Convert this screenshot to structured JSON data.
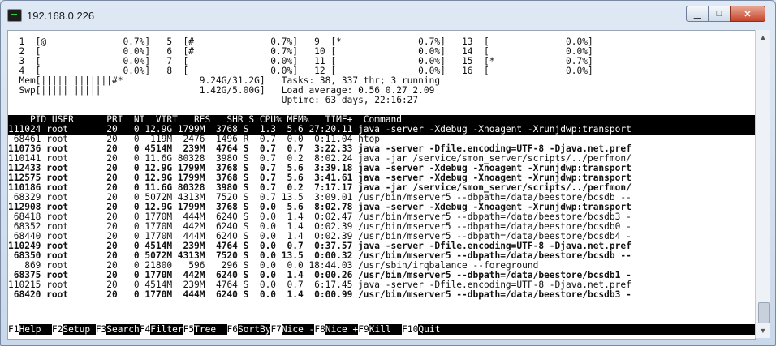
{
  "window": {
    "title": "192.168.0.226",
    "minimize": "▁",
    "maximize": "□",
    "close": "✕"
  },
  "scrollbar": {
    "up": "▲",
    "down": "▼"
  },
  "meters": [
    "  1  [@              0.7%]   5  [#              0.7%]   9  [*              0.7%]   13  [              0.0%]",
    "  2  [               0.0%]   6  [#              0.7%]   10 [               0.0%]   14  [              0.0%]",
    "  3  [               0.0%]   7  [               0.0%]   11 [               0.0%]   15  [*             0.7%]",
    "  4  [               0.0%]   8  [               0.0%]   12 [               0.0%]   16  [              0.0%]",
    "  Mem[|||||||||||||#*              9.24G/31.2G]   Tasks: 38, 337 thr; 3 running",
    "  Swp[|||||||||||                  1.42G/5.00G]   Load average: 0.56 0.27 2.09",
    "                                                  Uptime: 63 days, 22:16:27"
  ],
  "table": {
    "header": "    PID USER      PRI  NI  VIRT   RES   SHR S CPU% MEM%   TIME+  Command",
    "rows": [
      "111024 root       20   0 12.9G 1799M  3768 S  1.3  5.6 27:20.11 java -server -Xdebug -Xnoagent -Xrunjdwp:transport",
      " 68461 root       20   0  119M  2476  1496 R  0.7  0.0  0:11.04 htop",
      "110736 root       20   0 4514M  239M  4764 S  0.7  0.7  3:22.33 java -server -Dfile.encoding=UTF-8 -Djava.net.pref",
      "110141 root       20   0 11.6G 80328  3980 S  0.7  0.2  8:02.24 java -jar /service/smon_server/scripts/../perfmon/",
      "112433 root       20   0 12.9G 1799M  3768 S  0.7  5.6  3:39.18 java -server -Xdebug -Xnoagent -Xrunjdwp:transport",
      "112575 root       20   0 12.9G 1799M  3768 S  0.7  5.6  3:41.61 java -server -Xdebug -Xnoagent -Xrunjdwp:transport",
      "110186 root       20   0 11.6G 80328  3980 S  0.7  0.2  7:17.17 java -jar /service/smon_server/scripts/../perfmon/",
      " 68329 root       20   0 5072M 4313M  7520 S  0.7 13.5  3:09.01 /usr/bin/mserver5 --dbpath=/data/beestore/bcsdb --",
      "112908 root       20   0 12.9G 1799M  3768 S  0.0  5.6  8:02.78 java -server -Xdebug -Xnoagent -Xrunjdwp:transport",
      " 68418 root       20   0 1770M  444M  6240 S  0.0  1.4  0:02.47 /usr/bin/mserver5 --dbpath=/data/beestore/bcsdb3 -",
      " 68352 root       20   0 1770M  442M  6240 S  0.0  1.4  0:02.39 /usr/bin/mserver5 --dbpath=/data/beestore/bcsdb0 -",
      " 68440 root       20   0 1770M  444M  6240 S  0.0  1.4  0:02.39 /usr/bin/mserver5 --dbpath=/data/beestore/bcsdb4 -",
      "110249 root       20   0 4514M  239M  4764 S  0.0  0.7  0:37.57 java -server -Dfile.encoding=UTF-8 -Djava.net.pref",
      " 68350 root       20   0 5072M 4313M  7520 S  0.0 13.5  0:00.32 /usr/bin/mserver5 --dbpath=/data/beestore/bcsdb --",
      "   869 root       20   0 21800   596   296 S  0.0  0.0 18:44.03 /usr/sbin/irqbalance --foreground",
      " 68375 root       20   0 1770M  442M  6240 S  0.0  1.4  0:00.26 /usr/bin/mserver5 --dbpath=/data/beestore/bcsdb1 -",
      "110215 root       20   0 4514M  239M  4764 S  0.0  0.7  6:17.45 java -server -Dfile.encoding=UTF-8 -Djava.net.pref",
      " 68420 root       20   0 1770M  444M  6240 S  0.0  1.4  0:00.99 /usr/bin/mserver5 --dbpath=/data/beestore/bcsdb3 -"
    ]
  },
  "footer": [
    {
      "key": "F1",
      "label": "Help  "
    },
    {
      "key": "F2",
      "label": "Setup "
    },
    {
      "key": "F3",
      "label": "Search"
    },
    {
      "key": "F4",
      "label": "Filter"
    },
    {
      "key": "F5",
      "label": "Tree  "
    },
    {
      "key": "F6",
      "label": "SortBy"
    },
    {
      "key": "F7",
      "label": "Nice -"
    },
    {
      "key": "F8",
      "label": "Nice +"
    },
    {
      "key": "F9",
      "label": "Kill  "
    },
    {
      "key": "F10",
      "label": "Quit"
    }
  ]
}
